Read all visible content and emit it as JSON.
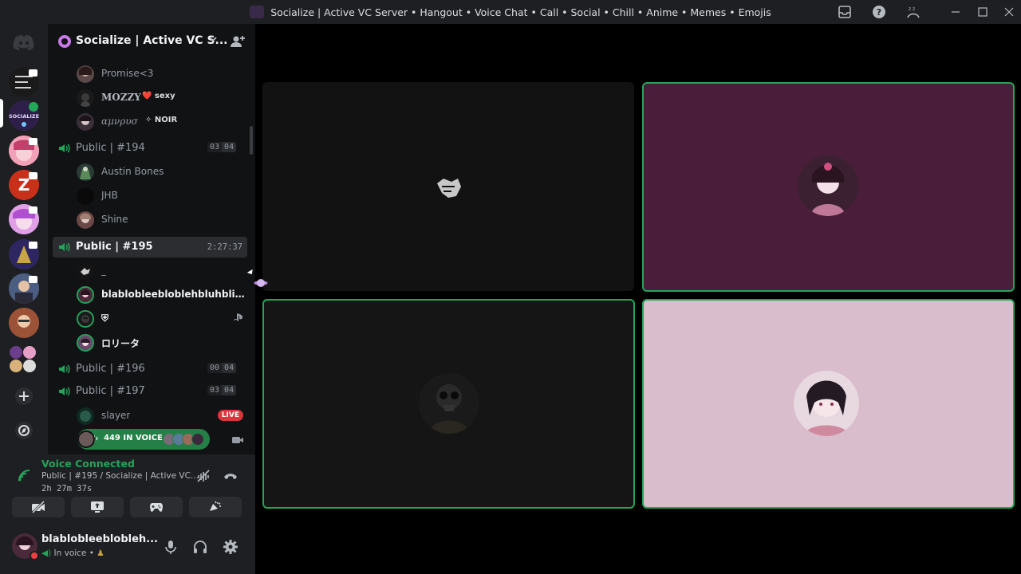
{
  "window": {
    "title": "Socialize | Active VC Server • Hangout • Voice Chat • Call • Social • Chill • Anime • Memes • Emojis",
    "controls": [
      "minimize",
      "maximize",
      "close"
    ],
    "toolbar_icons": [
      "inbox-icon",
      "help-icon",
      "sleep-icon"
    ]
  },
  "server": {
    "name": "Socialize | Active VC S...",
    "header_icons": [
      "boost-icon",
      "chevron-down-icon",
      "invite-icon"
    ]
  },
  "channels": [
    {
      "type": "users-only",
      "users": [
        {
          "name": "Promise<3",
          "tag": ""
        },
        {
          "name": "MOZZY",
          "tag": "❤️ sexy"
        },
        {
          "name": "αμνρυσ",
          "tag": "✧ NOIR"
        }
      ]
    },
    {
      "name": "Public | #194",
      "count_in": "03",
      "count_max": "04",
      "users": [
        {
          "name": "Austin Bones"
        },
        {
          "name": "JHB"
        },
        {
          "name": "Shine"
        }
      ]
    },
    {
      "name": "Public | #195",
      "active": true,
      "timer": "2:27:37",
      "users": [
        {
          "name": "_",
          "bright": false
        },
        {
          "name": "blablobleebloblehbluhblible...",
          "bright": true
        },
        {
          "name": "⛨",
          "bright": true,
          "playstation": true
        },
        {
          "name": "ロリータ",
          "bright": true
        }
      ]
    },
    {
      "name": "Public | #196",
      "count_in": "00",
      "count_max": "04"
    },
    {
      "name": "Public | #197",
      "count_in": "03",
      "count_max": "04",
      "users": [
        {
          "name": "slayer",
          "live": "LIVE"
        }
      ]
    }
  ],
  "in_voice_pill": {
    "label": "449 IN VOICE"
  },
  "voice_panel": {
    "title": "Voice Connected",
    "subtitle": "Public | #195 / Socialize | Active VC...",
    "elapsed": "2h 27m 37s",
    "buttons": [
      "camera-off-icon",
      "screen-share-icon",
      "activities-icon",
      "soundboard-icon"
    ]
  },
  "user_panel": {
    "name": "blablobleeblobleh...",
    "status": "In voice •"
  },
  "stage": {
    "tiles": [
      {
        "label": "participant-1",
        "bg": "#121212",
        "speaking": false
      },
      {
        "label": "participant-2",
        "bg": "#4a1e3a",
        "speaking": true
      },
      {
        "label": "participant-3",
        "bg": "#151515",
        "speaking": true
      },
      {
        "label": "participant-4",
        "bg": "#d9bdcc",
        "speaking": true
      }
    ]
  },
  "colors": {
    "accent_green": "#23a55a",
    "live_red": "#da373c",
    "sidebar_bg": "#111214",
    "panel_bg": "#1e1f22"
  }
}
